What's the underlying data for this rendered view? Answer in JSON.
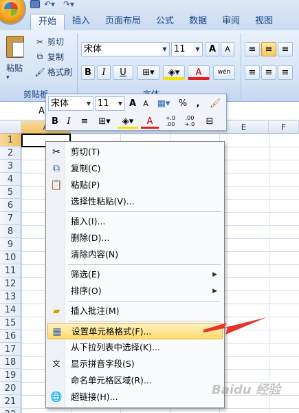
{
  "tabs": [
    "开始",
    "插入",
    "页面布局",
    "公式",
    "数据",
    "审阅",
    "视图"
  ],
  "ribbon": {
    "clipboard": {
      "paste_label": "粘贴",
      "cut_label": "剪切",
      "copy_label": "复制",
      "format_painter_label": "格式刷",
      "group_label": "剪贴板"
    },
    "font": {
      "font_name": "宋体",
      "font_size": "11",
      "bold": "B",
      "italic": "I",
      "underline": "U",
      "color_letter": "A",
      "grow": "A",
      "shrink": "A",
      "pinyin": "wén",
      "group_label": "字体"
    }
  },
  "formula_bar": {
    "name_box": "A"
  },
  "columns": [
    "A",
    "B",
    "C",
    "D",
    "E",
    "F"
  ],
  "rows": [
    "1",
    "2",
    "3",
    "4",
    "5",
    "6",
    "7",
    "8",
    "9",
    "10",
    "11",
    "12",
    "13",
    "14",
    "15",
    "16",
    "17",
    "18",
    "19",
    "20",
    "21",
    "22",
    "23"
  ],
  "mini_toolbar": {
    "font_name": "宋体",
    "font_size": "11",
    "percent": "%",
    "comma": ",",
    "bold": "B",
    "italic": "I",
    "color_letter": "A",
    "inc_decimal": "+.0\n.00",
    "dec_decimal": ".00\n+.0"
  },
  "context_menu": {
    "items": [
      {
        "label": "剪切(T)",
        "icon": "scissors-icon"
      },
      {
        "label": "复制(C)",
        "icon": "copy-icon"
      },
      {
        "label": "粘贴(P)",
        "icon": "paste-icon"
      },
      {
        "label": "选择性粘贴(V)...",
        "icon": ""
      },
      {
        "label": "插入(I)...",
        "icon": ""
      },
      {
        "label": "删除(D)...",
        "icon": ""
      },
      {
        "label": "清除内容(N)",
        "icon": ""
      },
      {
        "label": "筛选(E)",
        "icon": "",
        "submenu": true
      },
      {
        "label": "排序(O)",
        "icon": "",
        "submenu": true
      },
      {
        "label": "插入批注(M)",
        "icon": "comment-icon"
      },
      {
        "label": "设置单元格格式(F)...",
        "icon": "format-cells-icon",
        "highlighted": true
      },
      {
        "label": "从下拉列表中选择(K)...",
        "icon": ""
      },
      {
        "label": "显示拼音字段(S)",
        "icon": "pinyin-icon"
      },
      {
        "label": "命名单元格区域(R)...",
        "icon": ""
      },
      {
        "label": "超链接(H)...",
        "icon": "hyperlink-icon"
      }
    ],
    "submenu_glyph": "▶"
  },
  "watermark": "Baidu 经验",
  "colors": {
    "ribbon": "#d5e3f5",
    "highlight": "#ffd96b",
    "arrow": "#e8322c"
  }
}
